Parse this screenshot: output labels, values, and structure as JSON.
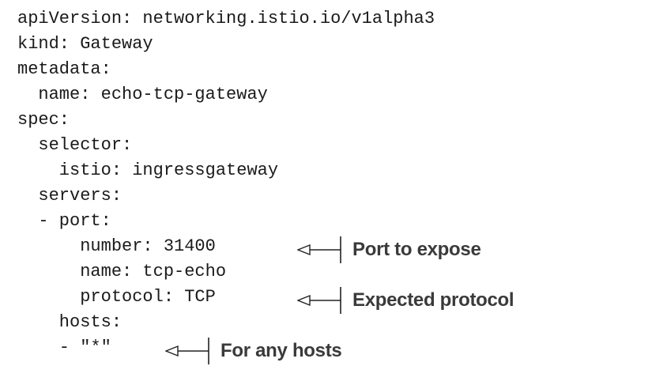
{
  "code": {
    "lines": [
      "apiVersion: networking.istio.io/v1alpha3",
      "kind: Gateway",
      "metadata:",
      "  name: echo-tcp-gateway",
      "spec:",
      "  selector:",
      "    istio: ingressgateway",
      "  servers:",
      "  - port:",
      "      number: 31400",
      "      name: tcp-echo",
      "      protocol: TCP",
      "    hosts:",
      "    - \"*\""
    ]
  },
  "annotations": {
    "port": "Port to expose",
    "protocol": "Expected protocol",
    "hosts": "For any hosts"
  },
  "colors": {
    "code_text": "#1a1a1a",
    "annotation_text": "#3a3a3a",
    "arrow": "#222222"
  }
}
